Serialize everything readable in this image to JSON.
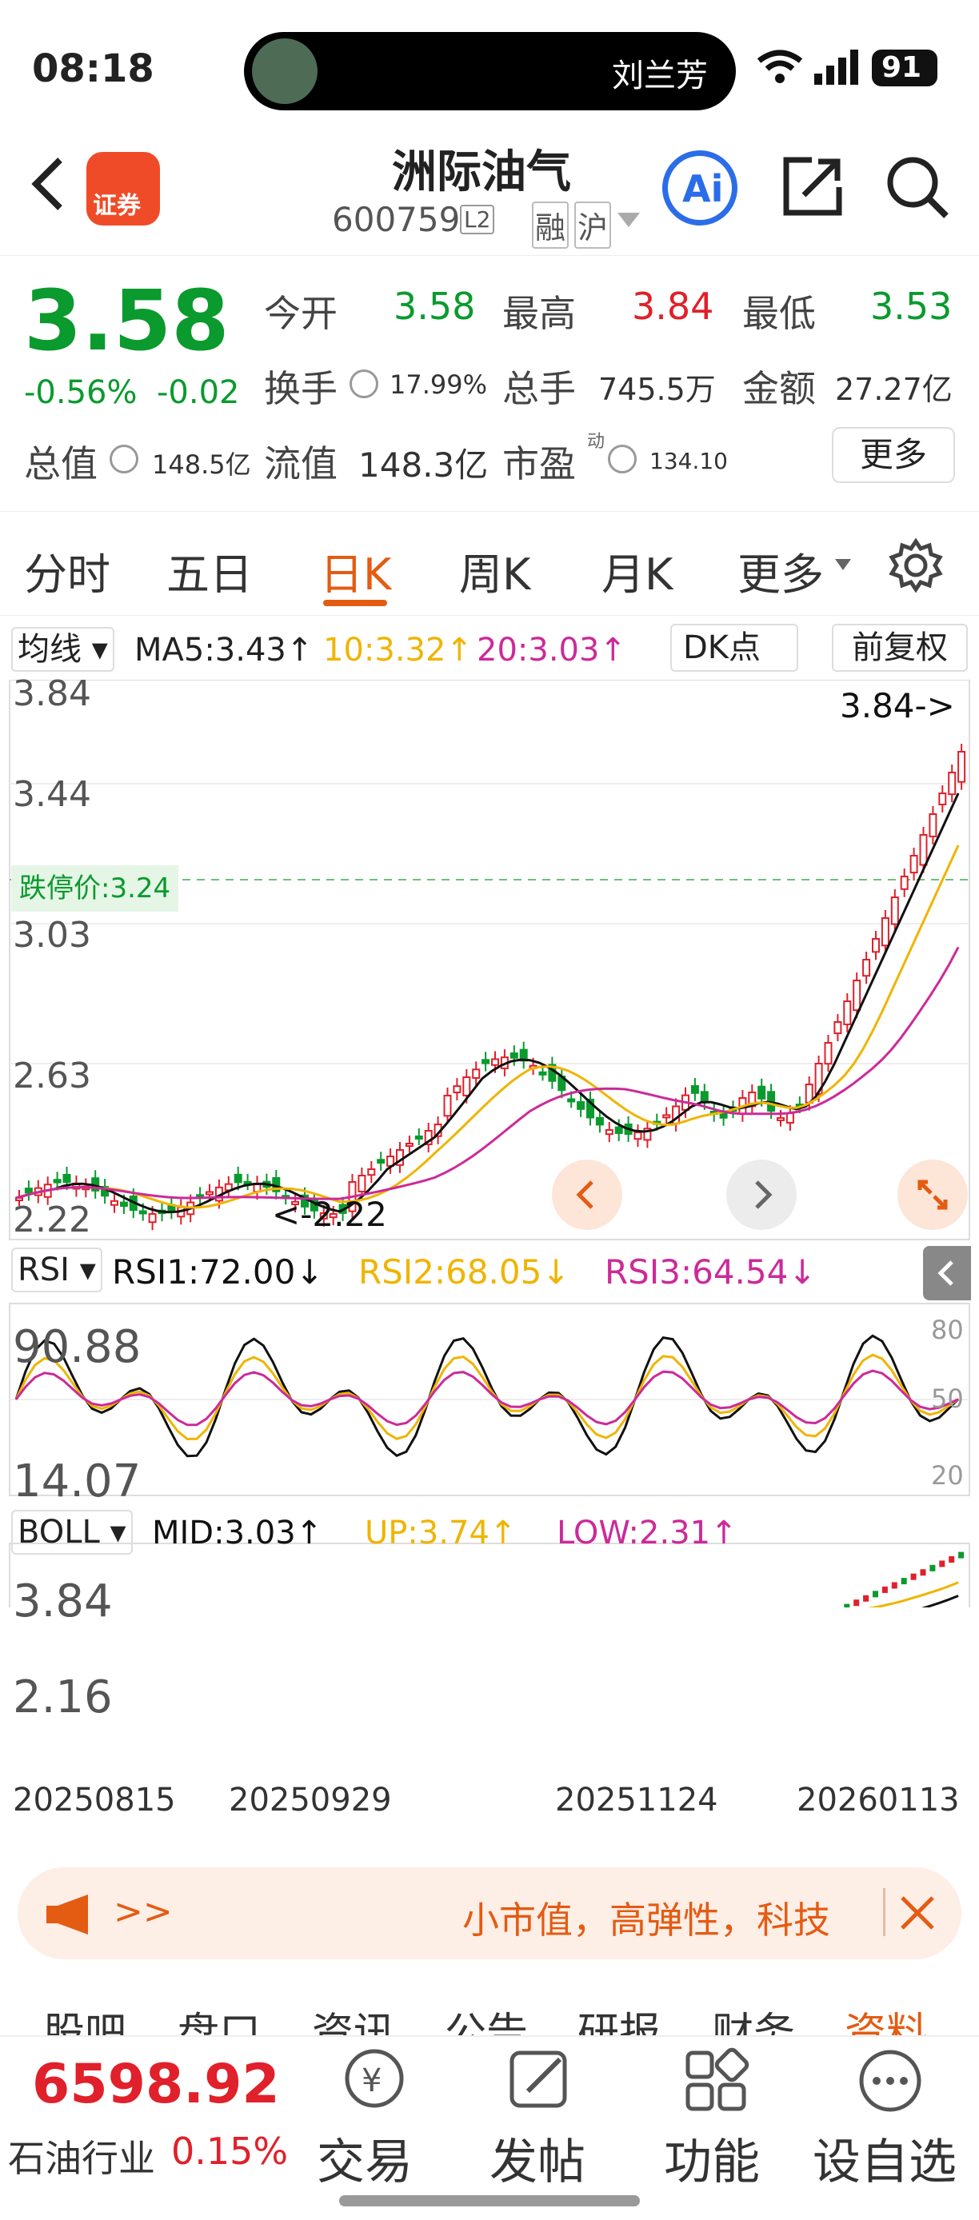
{
  "status": {
    "time": "08:18",
    "carrier": "刘兰芳",
    "battery": "91"
  },
  "header": {
    "title": "洲际油气",
    "code": "600759",
    "level": "L2",
    "tags": [
      "融",
      "沪"
    ],
    "broker": "证券"
  },
  "quote": {
    "price": "3.58",
    "pct": "-0.56%",
    "chg": "-0.02",
    "open_label": "今开",
    "open": "3.58",
    "high_label": "最高",
    "high": "3.84",
    "low_label": "最低",
    "low": "3.53",
    "turnover_label": "换手",
    "turnover": "17.99%",
    "volume_label": "总手",
    "volume": "745.5万",
    "amount_label": "金额",
    "amount": "27.27亿",
    "mcap_label": "总值",
    "mcap": "148.5亿",
    "float_label": "流值",
    "float": "148.3亿",
    "pe_label": "市盈",
    "pe_sup": "动",
    "pe": "134.10",
    "more": "更多"
  },
  "tabs": [
    "分时",
    "五日",
    "日K",
    "周K",
    "月K",
    "更多"
  ],
  "chart": {
    "ma_label": "均线",
    "ma5": "MA5:3.43",
    "ma10": "10:3.32",
    "ma20": "20:3.03",
    "dk": "DK点",
    "adj": "前复权",
    "y_labels": [
      "3.84",
      "3.44",
      "3.03",
      "2.63",
      "2.22"
    ],
    "limit_down": "跌停价:3.24",
    "high_marker": "3.84->",
    "low_marker": "<-2.22",
    "rsi_label": "RSI",
    "rsi1": "RSI1:72.00",
    "rsi2": "RSI2:68.05",
    "rsi3": "RSI3:64.54",
    "rsi_y": [
      "90.88",
      "14.07"
    ],
    "rsi_ref": [
      "80",
      "50",
      "20"
    ],
    "boll_label": "BOLL",
    "mid": "MID:3.03",
    "up": "UP:3.74",
    "low": "LOW:2.31",
    "boll_y": [
      "3.84",
      "2.16"
    ],
    "dates": [
      "20250815",
      "20250929",
      "20251124",
      "20260113"
    ],
    "arrows": [
      "↑",
      "↑",
      "↑",
      "↓",
      "↓",
      "↓"
    ]
  },
  "banner": {
    "prefix": ">>",
    "text": "小市值，高弹性，科技"
  },
  "subtabs": [
    "股吧",
    "盘口",
    "资讯",
    "公告",
    "研报",
    "财务",
    "资料"
  ],
  "bottom": {
    "index": "6598.92",
    "industry": "石油行业",
    "industry_pct": "0.15%",
    "nav": [
      "交易",
      "发帖",
      "功能",
      "设自选"
    ]
  },
  "colors": {
    "up": "#e0202a",
    "down": "#0a9a2e",
    "ma10": "#f0b400",
    "ma20": "#cc2a99",
    "accent": "#e45b12"
  }
}
